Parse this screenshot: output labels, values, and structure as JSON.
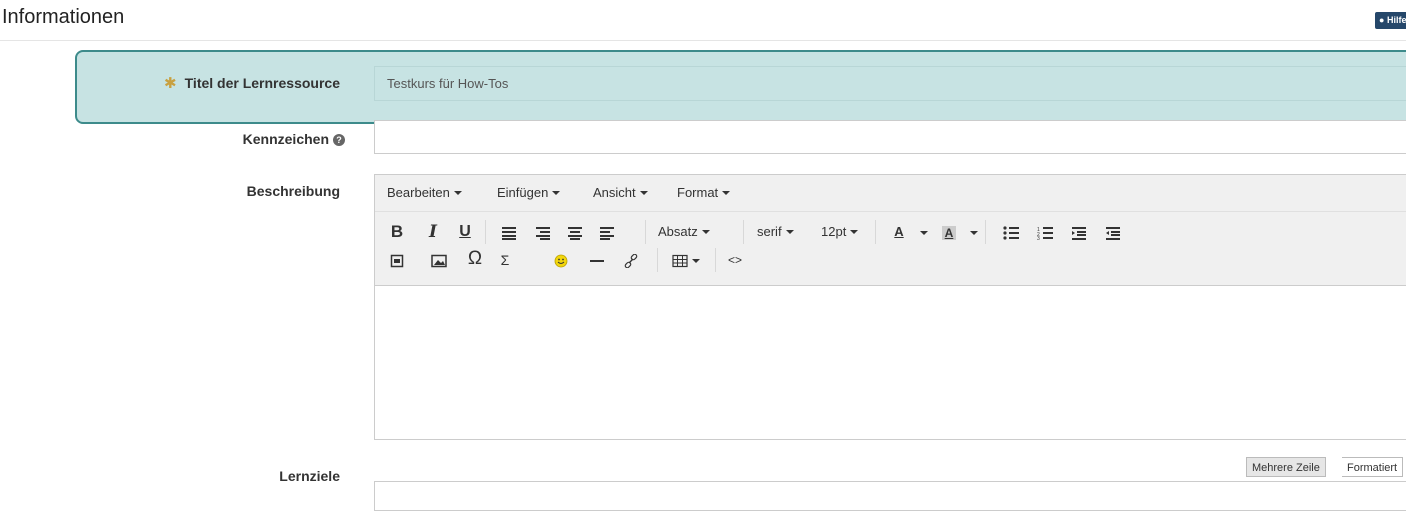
{
  "header": {
    "title": "Informationen",
    "help_label": "Hilfe"
  },
  "fields": {
    "title": {
      "label": "Titel der Lernressource",
      "value": "Testkurs für How-Tos",
      "required": true
    },
    "kennzeichen": {
      "label": "Kennzeichen",
      "value": ""
    },
    "beschreibung": {
      "label": "Beschreibung"
    },
    "lernziele": {
      "label": "Lernziele"
    }
  },
  "editor": {
    "menus": [
      "Bearbeiten",
      "Einfügen",
      "Ansicht",
      "Format"
    ],
    "row1": {
      "bold": "B",
      "italic": "I",
      "underline": "U",
      "paragraph": "Absatz",
      "font": "serif",
      "size": "12pt",
      "font_color": "A",
      "bg_color": "A"
    },
    "row2": {
      "omega": "Ω",
      "sigma": "Σ",
      "code": "<>"
    }
  },
  "lernziele_modes": [
    "Mehrere Zeile",
    "Formatiert"
  ],
  "colors": {
    "highlight_bg": "#c7e3e3",
    "highlight_border": "#3d8b8b",
    "required_star": "#c8a040",
    "help_bg": "#25476a"
  }
}
